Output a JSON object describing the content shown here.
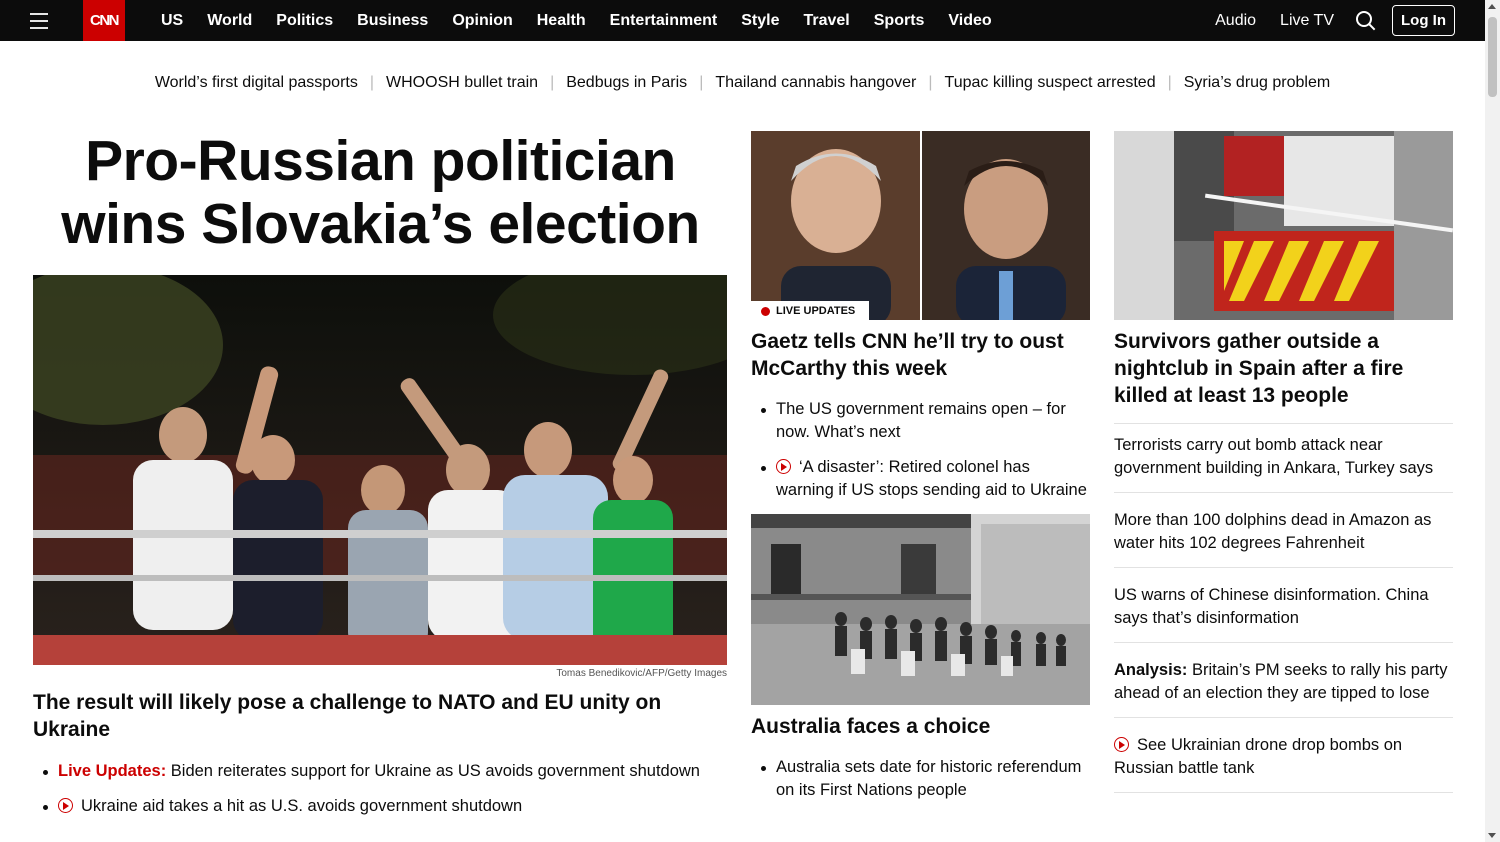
{
  "nav": {
    "logo": "CNN",
    "links": [
      "US",
      "World",
      "Politics",
      "Business",
      "Opinion",
      "Health",
      "Entertainment",
      "Style",
      "Travel",
      "Sports",
      "Video"
    ],
    "audio": "Audio",
    "live_tv": "Live TV",
    "login": "Log In"
  },
  "trending": [
    "World’s first digital passports",
    "WHOOSH bullet train",
    "Bedbugs in Paris",
    "Thailand cannabis hangover",
    "Tupac killing suspect arrested",
    "Syria’s drug problem"
  ],
  "lead": {
    "headline": "Pro-Russian politician wins Slovakia’s election",
    "image_credit": "Tomas Benedikovic/AFP/Getty Images",
    "subhead": "The result will likely pose a challenge to NATO and EU unity on Ukraine",
    "bullets": [
      {
        "label": "Live Updates:",
        "text": " Biden reiterates support for Ukraine as US avoids government shutdown"
      },
      {
        "text": "Ukraine aid takes a hit as U.S. avoids government shutdown"
      }
    ]
  },
  "middle": {
    "badge": "LIVE UPDATES",
    "headline": "Gaetz tells CNN he’ll try to oust McCarthy this week",
    "bullets": [
      "The US government remains open – for now. What’s next",
      "‘A disaster’: Retired colonel has warning if US stops sending aid to Ukraine"
    ],
    "headline2": "Australia faces a choice",
    "bullets2": [
      "Australia sets date for historic referendum on its First Nations people"
    ]
  },
  "right": {
    "headline": "Survivors gather outside a nightclub in Spain after a fire killed at least 13 people",
    "stories": [
      {
        "text": "Terrorists carry out bomb attack near government building in Ankara, Turkey says"
      },
      {
        "text": "More than 100 dolphins dead in Amazon as water hits 102 degrees Fahrenheit"
      },
      {
        "text": "US warns of Chinese disinformation. China says that’s disinformation"
      },
      {
        "label": "Analysis:",
        "text": " Britain’s PM seeks to rally his party ahead of an election they are tipped to lose"
      },
      {
        "text": "See Ukrainian drone drop bombs on Russian battle tank"
      }
    ]
  },
  "colors": {
    "brand_red": "#cc0000",
    "nav_bg": "#0c0c0c"
  }
}
